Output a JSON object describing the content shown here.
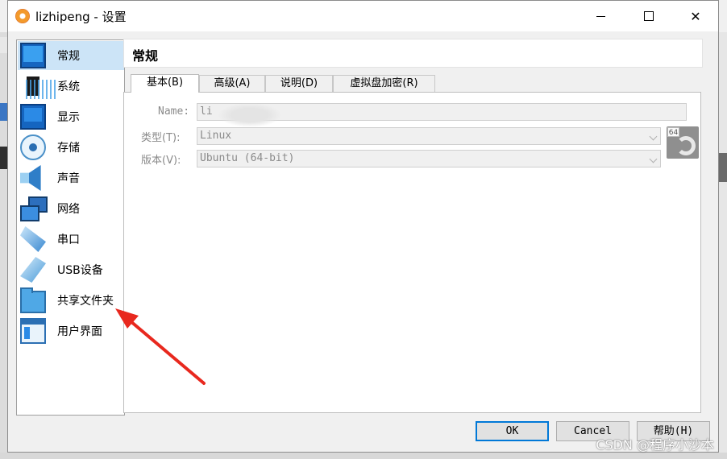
{
  "window": {
    "title": "lizhipeng - 设置"
  },
  "sidebar": {
    "items": [
      {
        "label": "常规",
        "icon": "general-icon",
        "selected": true
      },
      {
        "label": "系统",
        "icon": "chip-icon"
      },
      {
        "label": "显示",
        "icon": "monitor-icon"
      },
      {
        "label": "存储",
        "icon": "disk-icon"
      },
      {
        "label": "声音",
        "icon": "speaker-icon"
      },
      {
        "label": "网络",
        "icon": "network-icon"
      },
      {
        "label": "串口",
        "icon": "serial-port-icon"
      },
      {
        "label": "USB设备",
        "icon": "usb-icon"
      },
      {
        "label": "共享文件夹",
        "icon": "folder-icon"
      },
      {
        "label": "用户界面",
        "icon": "window-layout-icon"
      }
    ]
  },
  "panel": {
    "title": "常规"
  },
  "tabs": [
    {
      "label": "基本(B)",
      "active": true
    },
    {
      "label": "高级(A)"
    },
    {
      "label": "说明(D)"
    },
    {
      "label": "虚拟盘加密(R)"
    }
  ],
  "form": {
    "name_label": "Name:",
    "name_value": "li",
    "type_label": "类型(T):",
    "type_value": "Linux",
    "version_label": "版本(V):",
    "version_value": "Ubuntu (64-bit)",
    "os_badge": "64"
  },
  "buttons": {
    "ok": "OK",
    "cancel": "Cancel",
    "help": "帮助(H)"
  },
  "watermark": "CSDN @程序小沙本",
  "colors": {
    "accent": "#0078d7",
    "selected_bg": "#cce4f7",
    "annotation_arrow": "#e8281e"
  }
}
